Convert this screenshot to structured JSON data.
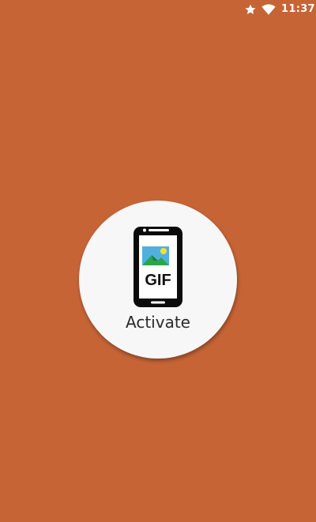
{
  "status_bar": {
    "time": "11:37",
    "icons": [
      "star-icon",
      "wifi-icon"
    ]
  },
  "activate": {
    "label": "Activate",
    "icon": "phone-gif-icon",
    "icon_text": "GIF"
  },
  "colors": {
    "background": "#C66436",
    "button": "#F7F7F7"
  }
}
